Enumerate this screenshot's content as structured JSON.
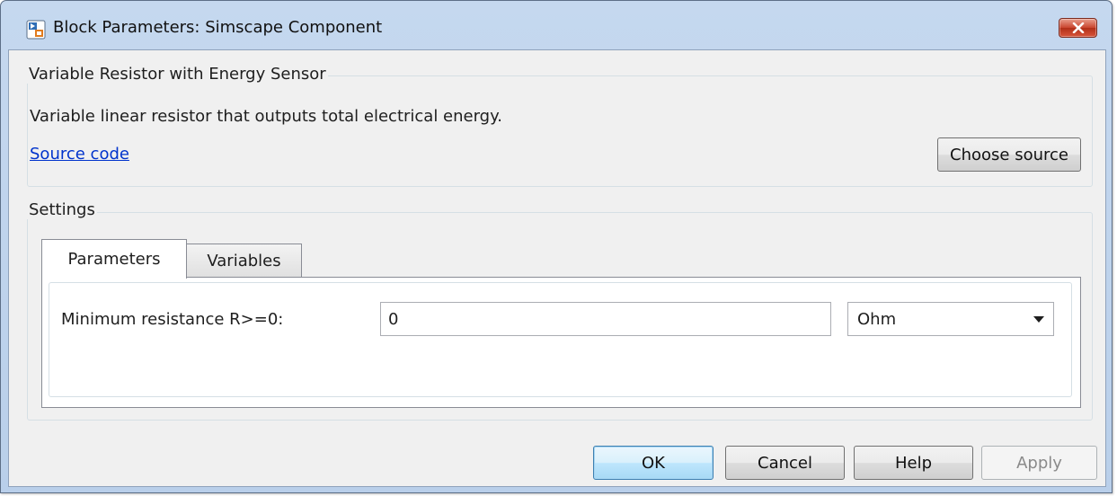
{
  "window": {
    "title": "Block Parameters: Simscape Component"
  },
  "component": {
    "group_title": "Variable Resistor with Energy Sensor",
    "description": "Variable linear resistor that outputs total electrical energy.",
    "source_link": "Source code",
    "choose_source_label": "Choose source"
  },
  "settings": {
    "group_title": "Settings",
    "tabs": [
      {
        "label": "Parameters",
        "active": true
      },
      {
        "label": "Variables",
        "active": false
      }
    ],
    "params": [
      {
        "label": "Minimum resistance R>=0:",
        "value": "0",
        "unit": "Ohm"
      }
    ]
  },
  "footer": {
    "ok": "OK",
    "cancel": "Cancel",
    "help": "Help",
    "apply": "Apply"
  },
  "icons": {
    "app": "simulink-block-icon",
    "close": "close-icon",
    "dropdown": "chevron-down-icon"
  },
  "colors": {
    "title_bar": "#c5d8ef",
    "close_button": "#c9442d",
    "link": "#0033cc",
    "default_button": "#bee6fd"
  }
}
